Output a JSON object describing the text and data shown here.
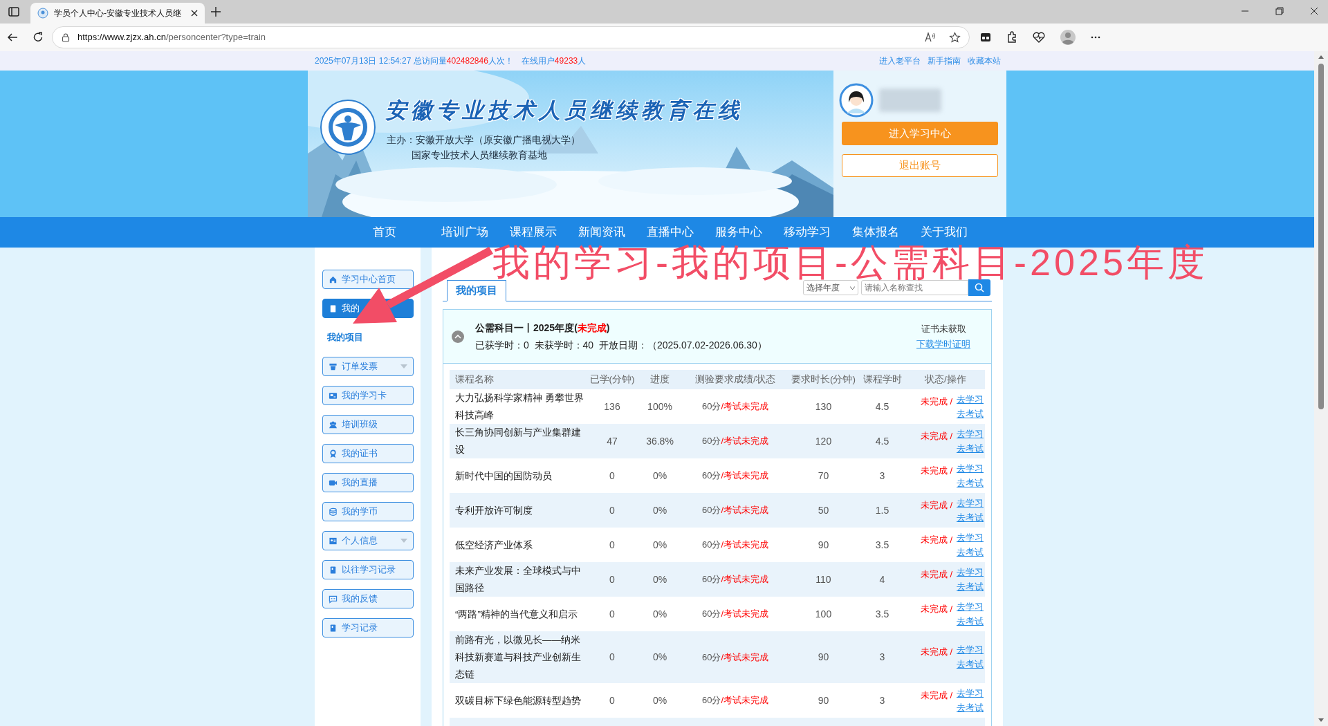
{
  "browser": {
    "tab_title": "学员个人中心-安徽专业技术人员继",
    "url_host": "https://www.zjzx.ah.cn",
    "url_path": "/personcenter?type=train"
  },
  "topbar": {
    "datetime": "2025年07月13日 12:54:27 总访问量",
    "visits": "402482846",
    "visits_unit": "人次！",
    "online_label": "在线用户",
    "online": "49233",
    "online_unit": "人",
    "links": [
      "进入老平台",
      "新手指南",
      "收藏本站"
    ]
  },
  "header": {
    "site_title": "安徽专业技术人员继续教育在线",
    "sponsor_lines": [
      "主办：安徽开放大学（原安徽广播电视大学）",
      "国家专业技术人员继续教育基地"
    ],
    "enter_button": "进入学习中心",
    "logout_button": "退出账号"
  },
  "nav": [
    "首页",
    "培训广场",
    "课程展示",
    "新闻资讯",
    "直播中心",
    "服务中心",
    "移动学习",
    "集体报名",
    "关于我们"
  ],
  "sidebar": [
    {
      "kind": "button",
      "label": "学习中心首页",
      "selected": false,
      "dropdown": false
    },
    {
      "kind": "button",
      "label": "我的",
      "selected": true,
      "dropdown": false
    },
    {
      "kind": "subitem",
      "label": "我的项目",
      "selected": true
    },
    {
      "kind": "button",
      "label": "订单发票",
      "selected": false,
      "dropdown": true
    },
    {
      "kind": "button",
      "label": "我的学习卡",
      "selected": false,
      "dropdown": false
    },
    {
      "kind": "button",
      "label": "培训班级",
      "selected": false,
      "dropdown": false
    },
    {
      "kind": "button",
      "label": "我的证书",
      "selected": false,
      "dropdown": false
    },
    {
      "kind": "button",
      "label": "我的直播",
      "selected": false,
      "dropdown": false
    },
    {
      "kind": "button",
      "label": "我的学币",
      "selected": false,
      "dropdown": false
    },
    {
      "kind": "button",
      "label": "个人信息",
      "selected": false,
      "dropdown": true
    },
    {
      "kind": "button",
      "label": "以往学习记录",
      "selected": false,
      "dropdown": false
    },
    {
      "kind": "button",
      "label": "我的反馈",
      "selected": false,
      "dropdown": false
    },
    {
      "kind": "button",
      "label": "学习记录",
      "selected": false,
      "dropdown": false
    }
  ],
  "content": {
    "tab": "我的项目",
    "year_select": "选择年度",
    "search": {
      "placeholder": "请输入名称查找"
    }
  },
  "project": {
    "title": "公需科目一丨2025年度(",
    "status": "未完成",
    "title_end": ")",
    "expanded": true,
    "stats": "已获学时：0  未获学时：40  开放日期：（2025.07.02-2026.06.30）",
    "cert_status": "证书未获取",
    "cert_link": "下载学时证明"
  },
  "table": {
    "columns": [
      "课程名称",
      "已学(分钟)",
      "进度",
      "测验要求成绩/状态",
      "要求时长(分钟)",
      "课程学时",
      "状态/操作"
    ],
    "rows": [
      {
        "name": "大力弘扬科学家精神 勇攀世界科技高峰",
        "studied": "136",
        "progress": "100%",
        "score": "60分",
        "quiz_status": "/考试未完成",
        "required": "130",
        "hours": "4.5",
        "status": "未完成 /",
        "actions": [
          "去学习",
          "去考试"
        ]
      },
      {
        "name": "长三角协同创新与产业集群建设",
        "studied": "47",
        "progress": "36.8%",
        "score": "60分",
        "quiz_status": "/考试未完成",
        "required": "120",
        "hours": "4.5",
        "status": "未完成 /",
        "actions": [
          "去学习",
          "去考试"
        ]
      },
      {
        "name": "新时代中国的国防动员",
        "studied": "0",
        "progress": "0%",
        "score": "60分",
        "quiz_status": "/考试未完成",
        "required": "70",
        "hours": "3",
        "status": "未完成 /",
        "actions": [
          "去学习",
          "去考试"
        ]
      },
      {
        "name": "专利开放许可制度",
        "studied": "0",
        "progress": "0%",
        "score": "60分",
        "quiz_status": "/考试未完成",
        "required": "50",
        "hours": "1.5",
        "status": "未完成 /",
        "actions": [
          "去学习",
          "去考试"
        ]
      },
      {
        "name": "低空经济产业体系",
        "studied": "0",
        "progress": "0%",
        "score": "60分",
        "quiz_status": "/考试未完成",
        "required": "90",
        "hours": "3.5",
        "status": "未完成 /",
        "actions": [
          "去学习",
          "去考试"
        ]
      },
      {
        "name": "未来产业发展：全球模式与中国路径",
        "studied": "0",
        "progress": "0%",
        "score": "60分",
        "quiz_status": "/考试未完成",
        "required": "110",
        "hours": "4",
        "status": "未完成 /",
        "actions": [
          "去学习",
          "去考试"
        ]
      },
      {
        "name": "“两路”精神的当代意义和启示",
        "studied": "0",
        "progress": "0%",
        "score": "60分",
        "quiz_status": "/考试未完成",
        "required": "100",
        "hours": "3.5",
        "status": "未完成 /",
        "actions": [
          "去学习",
          "去考试"
        ]
      },
      {
        "name": "前路有光，以微见长——纳米科技新赛道与科技产业创新生态链",
        "studied": "0",
        "progress": "0%",
        "score": "60分",
        "quiz_status": "/考试未完成",
        "required": "90",
        "hours": "3",
        "status": "未完成 /",
        "actions": [
          "去学习",
          "去考试"
        ]
      },
      {
        "name": "双碳目标下绿色能源转型趋势",
        "studied": "0",
        "progress": "0%",
        "score": "60分",
        "quiz_status": "/考试未完成",
        "required": "90",
        "hours": "3",
        "status": "未完成 /",
        "actions": [
          "去学习",
          "去考试"
        ]
      }
    ]
  },
  "annotation": {
    "text": "我的学习-我的项目-公需科目-2025年度"
  }
}
